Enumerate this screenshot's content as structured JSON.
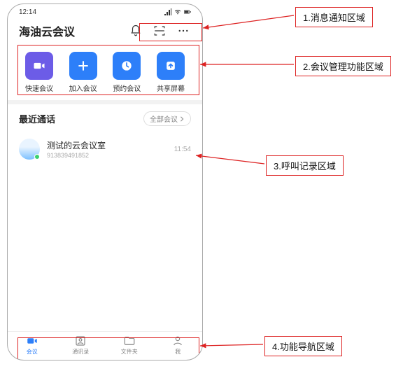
{
  "status": {
    "time": "12:14"
  },
  "header": {
    "title": "海油云会议",
    "icons": {
      "bell": "bell-icon",
      "scan": "scan-icon",
      "more": "more-icon"
    }
  },
  "actions": [
    {
      "label": "快速会议",
      "type": "video",
      "color": "purple"
    },
    {
      "label": "加入会议",
      "type": "plus",
      "color": "blue"
    },
    {
      "label": "预约会议",
      "type": "clock",
      "color": "blue"
    },
    {
      "label": "共享屏幕",
      "type": "share",
      "color": "blue"
    }
  ],
  "recent": {
    "title": "最近通话",
    "filter_label": "全部会议",
    "items": [
      {
        "title": "测试的云会议室",
        "sub": "913839491852",
        "time": "11:54"
      }
    ]
  },
  "bottom_nav": [
    {
      "label": "会议",
      "active": true,
      "type": "video"
    },
    {
      "label": "通讯录",
      "active": false,
      "type": "contacts"
    },
    {
      "label": "文件夹",
      "active": false,
      "type": "folder"
    },
    {
      "label": "我",
      "active": false,
      "type": "person"
    }
  ],
  "callouts": {
    "c1": "1.消息通知区域",
    "c2": "2.会议管理功能区域",
    "c3": "3.呼叫记录区域",
    "c4": "4.功能导航区域"
  }
}
